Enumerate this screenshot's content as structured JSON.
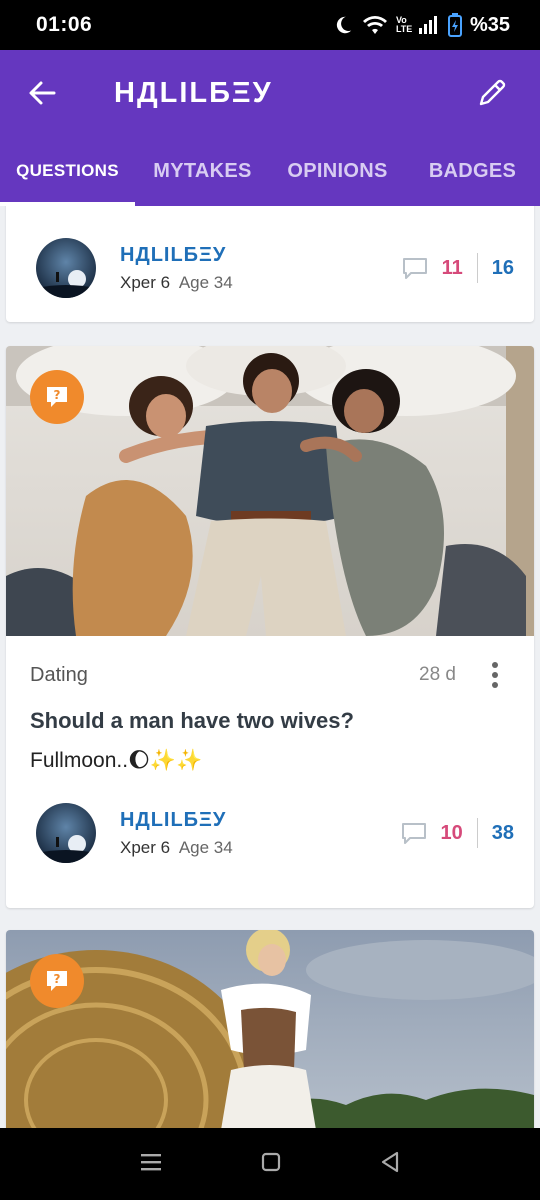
{
  "status_bar": {
    "time": "01:06",
    "network": "Vo LTE",
    "battery": "%35",
    "icons": [
      "moon-icon",
      "wifi-icon",
      "signal-icon",
      "battery-icon"
    ]
  },
  "app_bar": {
    "title": "НДLILБΞУ",
    "back_icon": "arrow-left-icon",
    "edit_icon": "pencil-icon"
  },
  "tabs": [
    {
      "label": "QUESTIONS",
      "active": true
    },
    {
      "label": "MYTAKES",
      "active": false
    },
    {
      "label": "OPINIONS",
      "active": false
    },
    {
      "label": "BADGES",
      "active": false
    }
  ],
  "feed": {
    "cards": [
      {
        "author": {
          "name": "НДLILБΞУ",
          "level": "Xper 6",
          "age": "Age 34"
        },
        "opinions": "11",
        "views": "16"
      },
      {
        "badge_icon": "question-bubble-icon",
        "category": "Dating",
        "date": "28 d",
        "title": "Should a man have two wives?",
        "body": "Fullmoon..🌔✨✨",
        "author": {
          "name": "НДLILБΞУ",
          "level": "Xper 6",
          "age": "Age 34"
        },
        "opinions": "10",
        "views": "38"
      },
      {
        "badge_icon": "question-bubble-icon"
      }
    ]
  },
  "colors": {
    "brand": "#6537bf",
    "author_link": "#1f6fb8",
    "opinions": "#d64a7a",
    "badge": "#f08a2c"
  },
  "nav_bar": {
    "icons": [
      "recents-icon",
      "home-icon",
      "back-triangle-icon"
    ]
  }
}
